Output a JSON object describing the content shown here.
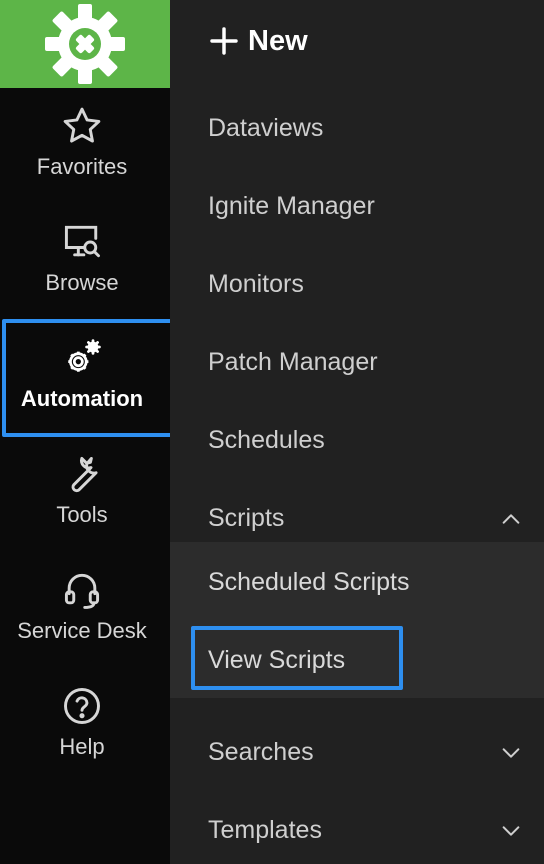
{
  "rail": {
    "logo_icon": "gear-logo-icon",
    "items": [
      {
        "label": "Favorites",
        "icon": "star-icon"
      },
      {
        "label": "Browse",
        "icon": "monitor-search-icon"
      },
      {
        "label": "Automation",
        "icon": "gears-icon",
        "active": true
      },
      {
        "label": "Tools",
        "icon": "wrench-icon"
      },
      {
        "label": "Service Desk",
        "icon": "headset-icon"
      },
      {
        "label": "Help",
        "icon": "help-circle-icon"
      }
    ]
  },
  "menu": {
    "new_label": "New",
    "items": [
      {
        "label": "Dataviews"
      },
      {
        "label": "Ignite Manager"
      },
      {
        "label": "Monitors"
      },
      {
        "label": "Patch Manager"
      },
      {
        "label": "Schedules"
      },
      {
        "label": "Scripts",
        "expanded": true
      },
      {
        "label": "Searches",
        "expanded": false
      },
      {
        "label": "Templates",
        "expanded": false
      }
    ],
    "scripts_children": [
      {
        "label": "Scheduled Scripts"
      },
      {
        "label": "View Scripts",
        "highlighted": true
      }
    ]
  },
  "colors": {
    "brand_green": "#5db548",
    "highlight_blue": "#2e8ff0",
    "rail_bg": "#0a0a0a",
    "menu_bg": "#212121"
  }
}
